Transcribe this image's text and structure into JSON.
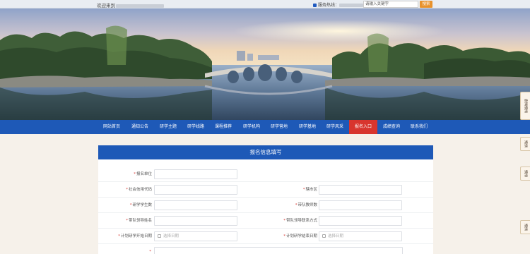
{
  "topbar": {
    "welcome_text": "欢迎来到",
    "hotline_label": "服务热线：",
    "search_placeholder": "请输入关键字",
    "search_button": "搜索"
  },
  "nav": {
    "items": [
      {
        "label": "网站首页"
      },
      {
        "label": "通知公告"
      },
      {
        "label": "研学主题"
      },
      {
        "label": "研学线路"
      },
      {
        "label": "课程推荐"
      },
      {
        "label": "研学机构"
      },
      {
        "label": "研学营地"
      },
      {
        "label": "研学基地"
      },
      {
        "label": "研学风采"
      },
      {
        "label": "报名入口",
        "active": true
      },
      {
        "label": "成绩查询"
      },
      {
        "label": "联系我们"
      }
    ]
  },
  "side_tabs": [
    "快速通道",
    "通道",
    "通道",
    "通道"
  ],
  "form": {
    "title": "报名信息填写",
    "fields": {
      "unit": "报名单位",
      "credit_code": "社会信用代码",
      "region": "辖市区",
      "students": "研学学生数",
      "teachers": "带队教师数",
      "leader_name": "带队领导姓名",
      "leader_contact": "带队领导联系方式",
      "start_date": "计划研学开始日期",
      "end_date": "计划研学结束日期",
      "date_placeholder": "选择日期"
    }
  },
  "colors": {
    "nav_blue": "#1e59b7",
    "active_red": "#d8352e",
    "search_orange": "#e8922c"
  }
}
